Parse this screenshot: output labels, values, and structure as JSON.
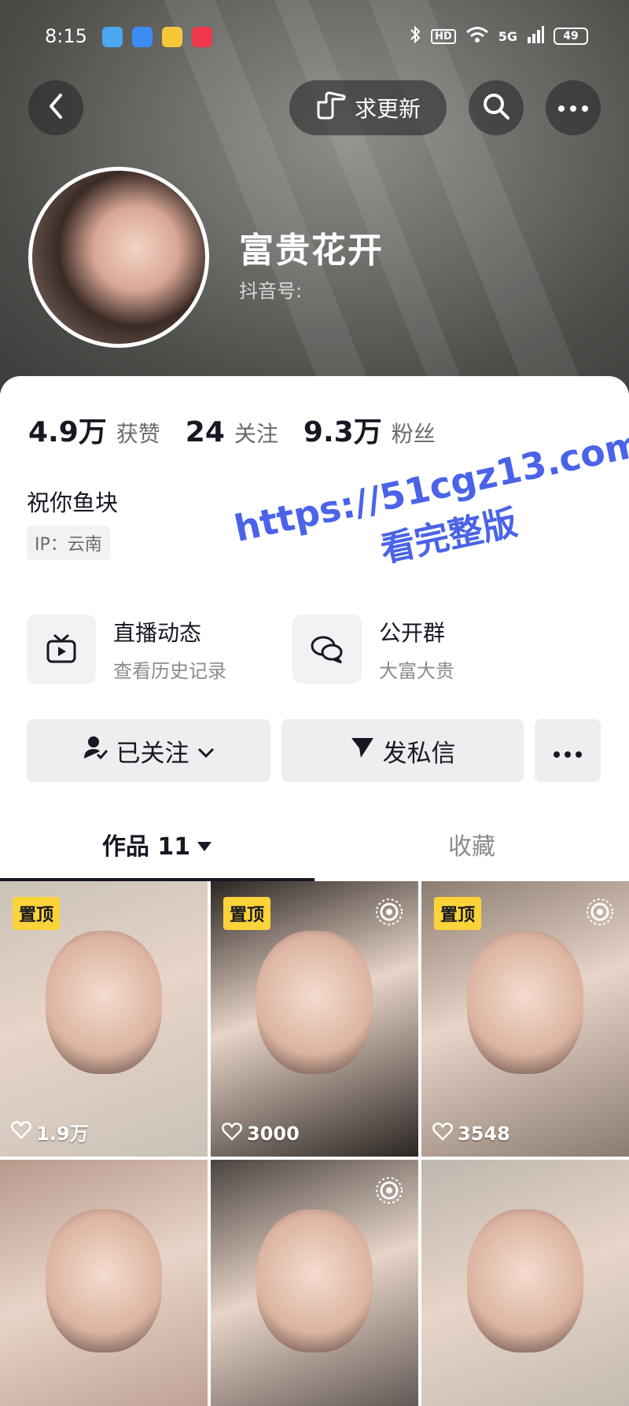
{
  "status_bar": {
    "time": "8:15",
    "network": "5G",
    "hd": "HD",
    "battery": "49",
    "icons": [
      "app-notif-icon",
      "app-notif-icon",
      "app-notif-icon",
      "app-notif-icon",
      "bluetooth-icon",
      "wifi-icon",
      "signal-icon",
      "battery-icon"
    ]
  },
  "header": {
    "request_update_label": "求更新",
    "nickname": "富贵花开",
    "douyin_id_label": "抖音号:"
  },
  "stats": {
    "likes_num": "4.9万",
    "likes_label": "获赞",
    "following_num": "24",
    "following_label": "关注",
    "fans_num": "9.3万",
    "fans_label": "粉丝"
  },
  "profile": {
    "signature": "祝你鱼块",
    "ip": "IP：云南"
  },
  "entries": [
    {
      "title": "直播动态",
      "subtitle": "查看历史记录"
    },
    {
      "title": "公开群",
      "subtitle": "大富大贵"
    }
  ],
  "actions": {
    "follow_label": "已关注",
    "message_label": "发私信"
  },
  "tabs": {
    "works_label": "作品 11",
    "favorites_label": "收藏"
  },
  "posts": [
    {
      "pinned": true,
      "pin_label": "置顶",
      "likes": "1.9万",
      "live": false,
      "bg": "#c9c2b8"
    },
    {
      "pinned": true,
      "pin_label": "置顶",
      "likes": "3000",
      "live": true,
      "bg": "#2b2622"
    },
    {
      "pinned": true,
      "pin_label": "置顶",
      "likes": "3548",
      "live": true,
      "bg": "#8c7c70"
    },
    {
      "pinned": false,
      "pin_label": "",
      "likes": "",
      "live": false,
      "bg": "#b79a8c"
    },
    {
      "pinned": false,
      "pin_label": "",
      "likes": "",
      "live": true,
      "bg": "#4a4440"
    },
    {
      "pinned": false,
      "pin_label": "",
      "likes": "",
      "live": false,
      "bg": "#bdb7ae"
    }
  ],
  "watermark": {
    "line1": "https://51cgz13.com",
    "line2": "看完整版"
  },
  "colors": {
    "pin_badge": "#fdd33a",
    "watermark": "#4a63e8"
  }
}
